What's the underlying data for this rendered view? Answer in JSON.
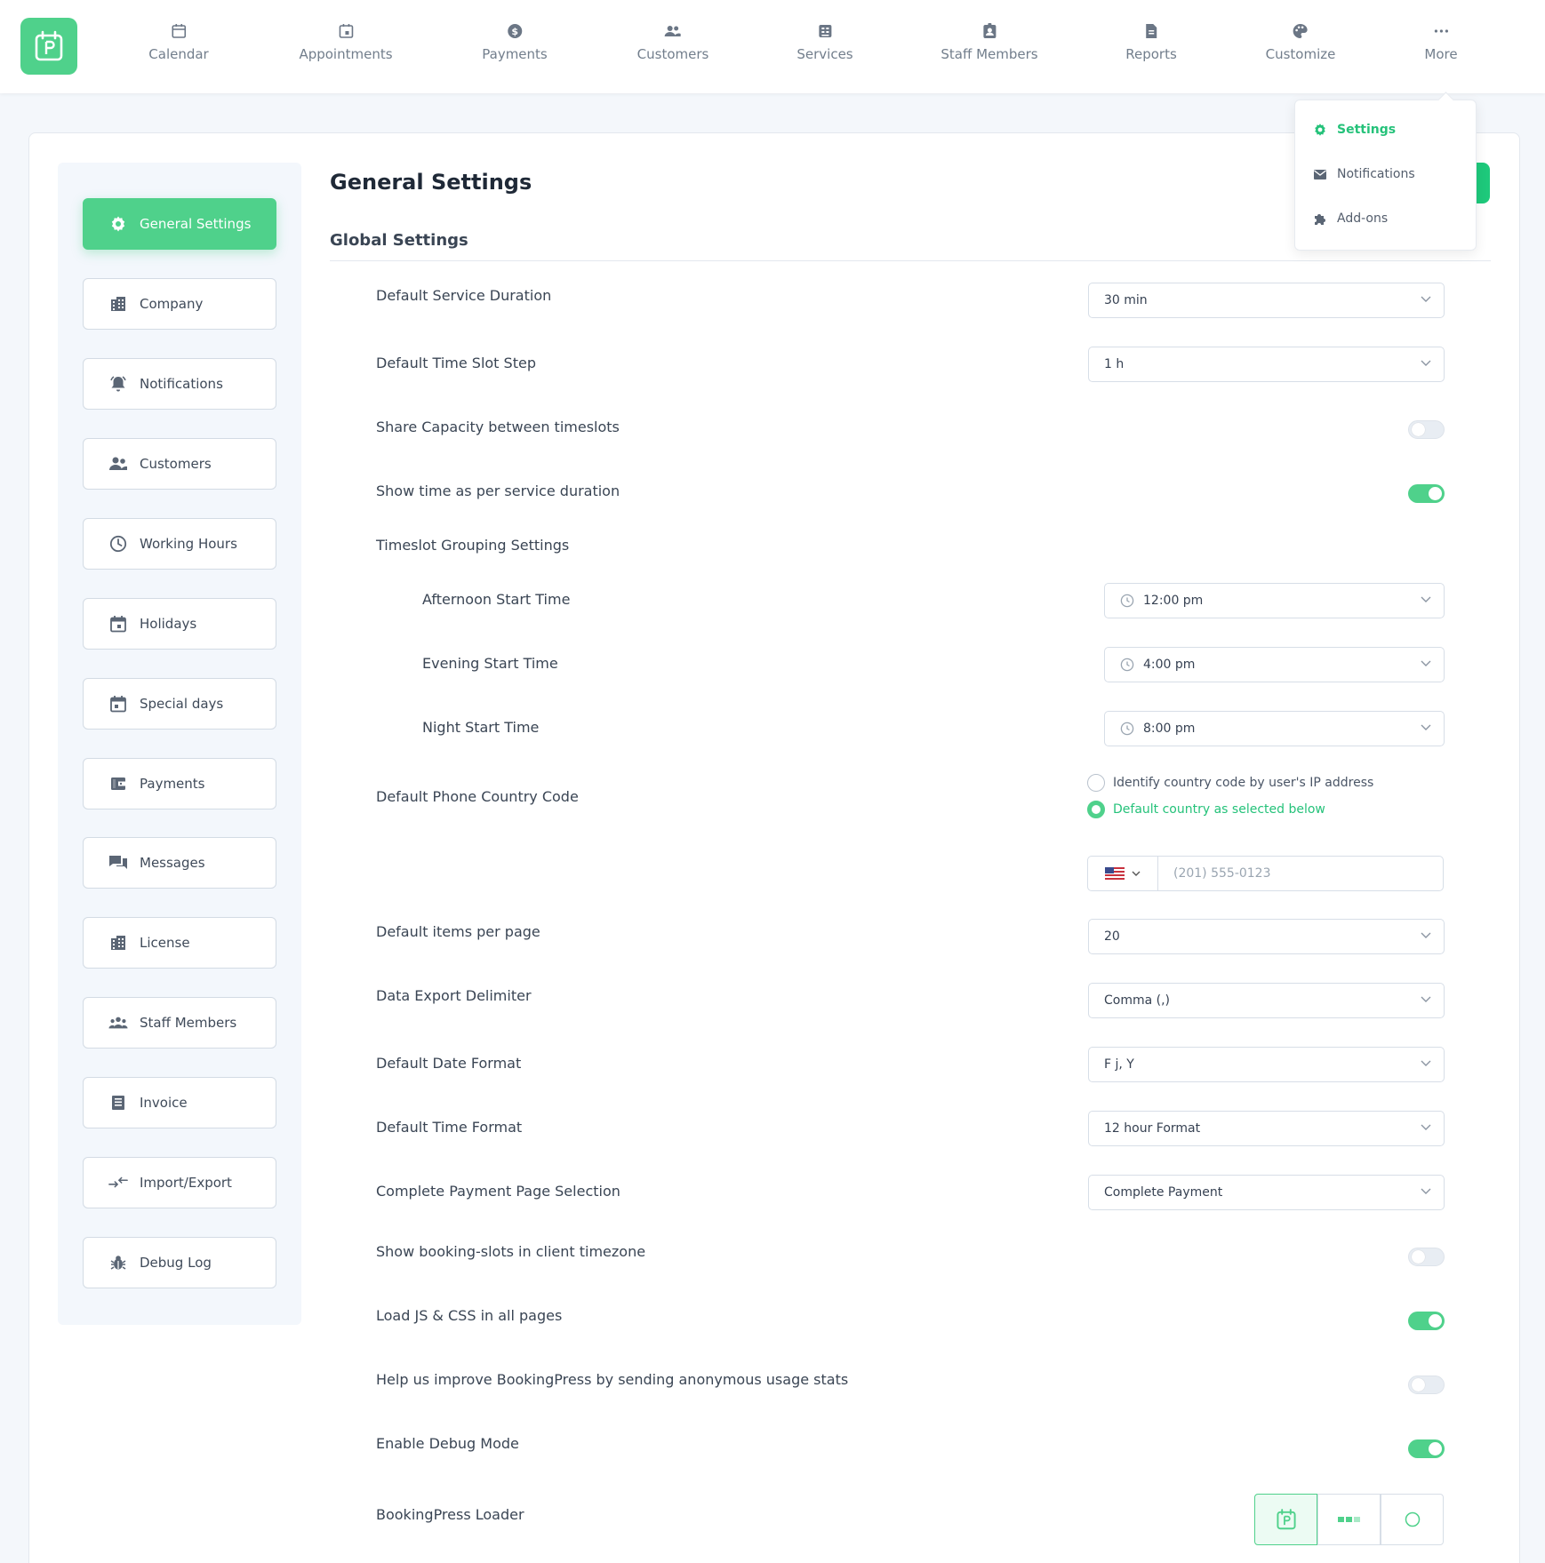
{
  "colors": {
    "accent": "#4fd18b",
    "accent_text": "#25c27a"
  },
  "nav": [
    {
      "label": "Calendar",
      "icon": "calendar-icon"
    },
    {
      "label": "Appointments",
      "icon": "appointment-icon"
    },
    {
      "label": "Payments",
      "icon": "dollar-icon"
    },
    {
      "label": "Customers",
      "icon": "customers-icon"
    },
    {
      "label": "Services",
      "icon": "services-icon"
    },
    {
      "label": "Staff Members",
      "icon": "staff-badge-icon"
    },
    {
      "label": "Reports",
      "icon": "report-icon"
    },
    {
      "label": "Customize",
      "icon": "palette-icon"
    },
    {
      "label": "More",
      "icon": "more-dots-icon"
    }
  ],
  "more_menu": [
    {
      "label": "Settings",
      "icon": "gear-icon",
      "active": true
    },
    {
      "label": "Notifications",
      "icon": "mail-icon"
    },
    {
      "label": "Add-ons",
      "icon": "puzzle-icon"
    }
  ],
  "sidebar": [
    {
      "label": "General Settings",
      "icon": "gear-icon",
      "active": true
    },
    {
      "label": "Company",
      "icon": "building-icon"
    },
    {
      "label": "Notifications",
      "icon": "bell-icon"
    },
    {
      "label": "Customers",
      "icon": "customers-icon"
    },
    {
      "label": "Working Hours",
      "icon": "clock-icon"
    },
    {
      "label": "Holidays",
      "icon": "calendar-icon"
    },
    {
      "label": "Special days",
      "icon": "calendar-icon"
    },
    {
      "label": "Payments",
      "icon": "wallet-icon"
    },
    {
      "label": "Messages",
      "icon": "chat-icon"
    },
    {
      "label": "License",
      "icon": "building-icon"
    },
    {
      "label": "Staff Members",
      "icon": "staff-icon"
    },
    {
      "label": "Invoice",
      "icon": "invoice-icon"
    },
    {
      "label": "Import/Export",
      "icon": "import-export-icon"
    },
    {
      "label": "Debug Log",
      "icon": "bug-icon"
    }
  ],
  "page": {
    "title": "General Settings",
    "section_title": "Global Settings"
  },
  "settings": {
    "default_service_duration": {
      "label": "Default Service Duration",
      "value": "30 min"
    },
    "default_time_slot_step": {
      "label": "Default Time Slot Step",
      "value": "1 h"
    },
    "share_capacity": {
      "label": "Share Capacity between timeslots",
      "enabled": false
    },
    "show_time_per_duration": {
      "label": "Show time as per service duration",
      "enabled": true
    },
    "timeslot_grouping": {
      "label": "Timeslot Grouping Settings"
    },
    "afternoon_start": {
      "label": "Afternoon Start Time",
      "value": "12:00 pm"
    },
    "evening_start": {
      "label": "Evening Start Time",
      "value": "4:00 pm"
    },
    "night_start": {
      "label": "Night Start Time",
      "value": "8:00 pm"
    },
    "phone_country_code": {
      "label": "Default Phone Country Code",
      "option_ip": "Identify country code by user's IP address",
      "option_default": "Default country as selected below",
      "selected": "option_default",
      "phone_placeholder": "(201) 555-0123"
    },
    "items_per_page": {
      "label": "Default items per page",
      "value": "20"
    },
    "export_delimiter": {
      "label": "Data Export Delimiter",
      "value": "Comma (,)"
    },
    "date_format": {
      "label": "Default Date Format",
      "value": "F j, Y"
    },
    "time_format": {
      "label": "Default Time Format",
      "value": "12 hour Format"
    },
    "payment_page": {
      "label": "Complete Payment Page Selection",
      "value": "Complete Payment"
    },
    "client_timezone": {
      "label": "Show booking-slots in client timezone",
      "enabled": false
    },
    "load_js_css": {
      "label": "Load JS & CSS in all pages",
      "enabled": true
    },
    "usage_stats": {
      "label": "Help us improve BookingPress by sending anonymous usage stats",
      "enabled": false
    },
    "debug_mode": {
      "label": "Enable Debug Mode",
      "enabled": true
    },
    "loader": {
      "label": "BookingPress Loader",
      "selected": 0
    }
  }
}
